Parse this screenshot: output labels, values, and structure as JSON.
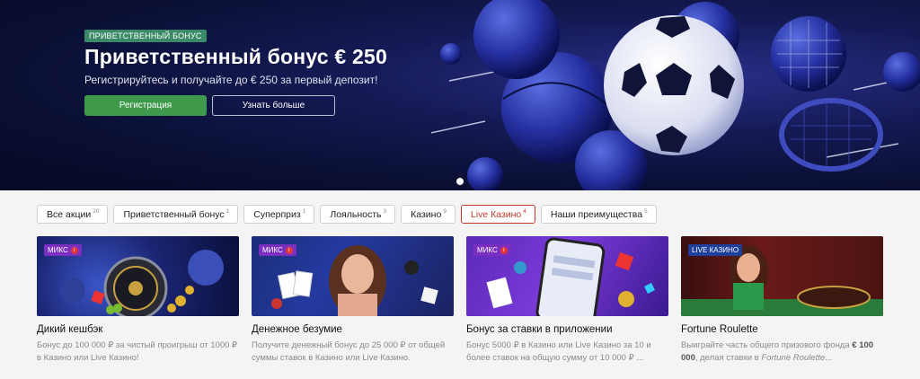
{
  "hero": {
    "badge": "ПРИВЕТСТВЕННЫЙ БОНУС",
    "title": "Приветственный бонус € 250",
    "subtitle": "Регистрируйтесь и получайте до € 250 за первый депозит!",
    "register_label": "Регистрация",
    "more_label": "Узнать больше"
  },
  "tabs": [
    {
      "label": "Все акции",
      "count": "20"
    },
    {
      "label": "Приветственный бонус",
      "count": "1"
    },
    {
      "label": "Суперприз",
      "count": "1"
    },
    {
      "label": "Лояльность",
      "count": "3"
    },
    {
      "label": "Казино",
      "count": "9"
    },
    {
      "label": "Live Казино",
      "count": "4"
    },
    {
      "label": "Наши преимущества",
      "count": "5"
    }
  ],
  "cards": [
    {
      "tag": "МИКС",
      "title": "Дикий кешбэк",
      "desc": "Бонус до 100 000 ₽ за чистый проигрыш от 1000 ₽ в Казино или Live Казино!"
    },
    {
      "tag": "МИКС",
      "title": "Денежное безумие",
      "desc": "Получите денежный бонус до 25 000 ₽ от общей суммы ставок в Казино или Live Казино."
    },
    {
      "tag": "МИКС",
      "title": "Бонус за ставки в приложении",
      "desc": "Бонус 5000 ₽ в Казино или Live Казино за 10 и более ставок на общую сумму от 10 000 ₽ ..."
    },
    {
      "tag": "LIVE КАЗИНО",
      "title": "Fortune Roulette",
      "desc_part1": "Выиграйте часть общего призового фонда ",
      "desc_bold": "€ 100 000",
      "desc_part2": ", делая ставки в ",
      "desc_italic": "Fortune Roulette",
      "desc_part3": "..."
    }
  ],
  "colors": {
    "accent_green": "#3f9a4c",
    "active_tab": "#c0392b",
    "badge_green": "#3a8a6a",
    "mix_tag": "#7a2fc0",
    "live_tag": "#1e3f9a"
  }
}
